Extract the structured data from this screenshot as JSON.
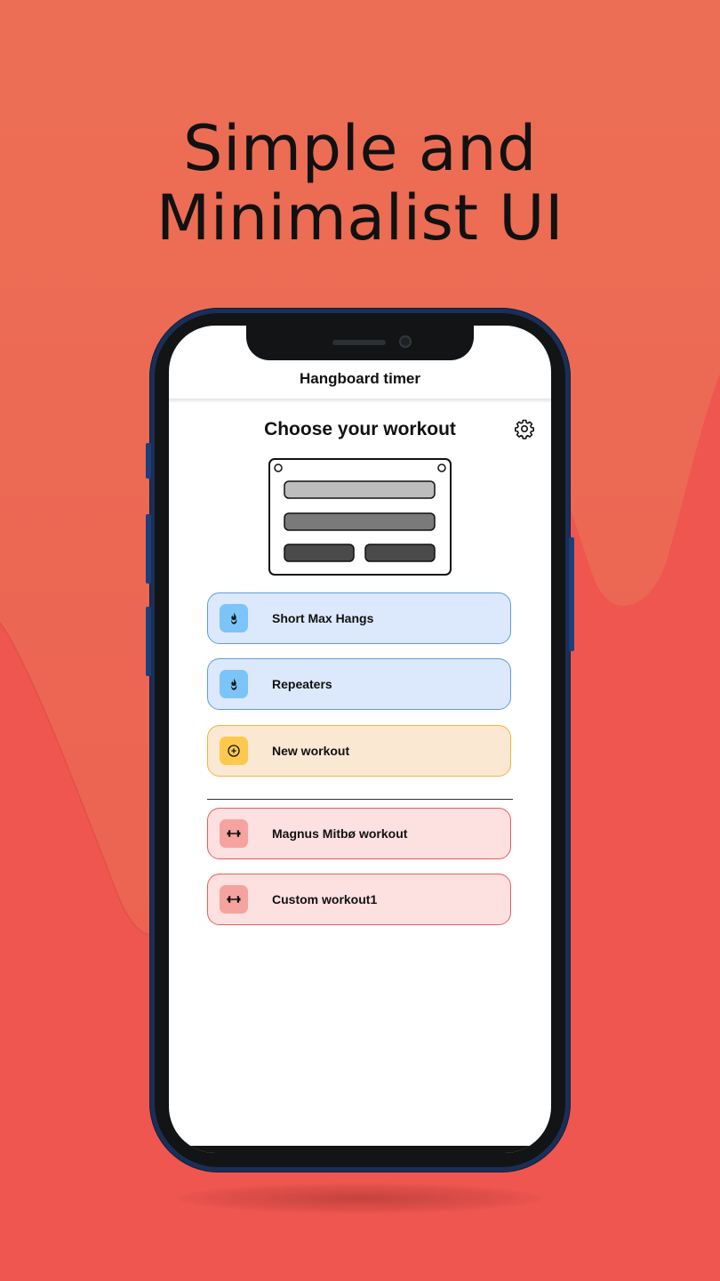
{
  "headline": {
    "line1": "Simple and",
    "line2": "Minimalist UI"
  },
  "colors": {
    "background_top": "#ec6f55",
    "background_bottom": "#ef5650",
    "phone_frame": "#1a2f57",
    "card_blue_bg": "#dce8fb",
    "card_blue_border": "#5f9ae6",
    "card_amber_bg": "#fbe8d2",
    "card_amber_border": "#f0b43a",
    "card_red_bg": "#fde0e0",
    "card_red_border": "#ea5d5a"
  },
  "app": {
    "appbar_title": "Hangboard timer",
    "page_title": "Choose your workout",
    "settings_icon": "gear-icon",
    "hangboard_illustration": "hangboard-icon",
    "workouts": [
      {
        "label": "Short Max Hangs",
        "icon": "flame-icon",
        "style": "blue"
      },
      {
        "label": "Repeaters",
        "icon": "flame-icon",
        "style": "blue"
      },
      {
        "label": "New workout",
        "icon": "plus-circle-icon",
        "style": "amber"
      }
    ],
    "custom_workouts": [
      {
        "label": "Magnus Mitbø workout",
        "icon": "dumbbell-icon",
        "style": "red"
      },
      {
        "label": "Custom workout1",
        "icon": "dumbbell-icon",
        "style": "red"
      }
    ]
  }
}
